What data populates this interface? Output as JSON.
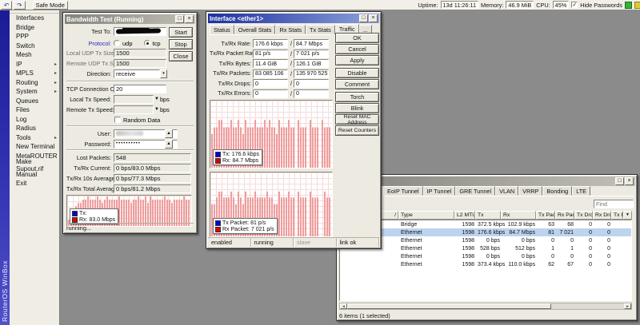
{
  "topbar": {
    "undo_icon": "↶",
    "redo_icon": "↷",
    "safe_mode_label": "Safe Mode",
    "uptime_label": "Uptime:",
    "uptime_value": "13d 11:26:11",
    "memory_label": "Memory:",
    "memory_value": "46.9 MiB",
    "cpu_label": "CPU:",
    "cpu_value": "45%",
    "hide_passwords_label": "Hide Passwords",
    "checkmark": "✓"
  },
  "sidebar": {
    "brand": "RouterOS WinBox",
    "items": [
      {
        "label": "Interfaces",
        "submenu": false
      },
      {
        "label": "Bridge",
        "submenu": false
      },
      {
        "label": "PPP",
        "submenu": false
      },
      {
        "label": "Switch",
        "submenu": false
      },
      {
        "label": "Mesh",
        "submenu": false
      },
      {
        "label": "IP",
        "submenu": true
      },
      {
        "label": "MPLS",
        "submenu": true
      },
      {
        "label": "Routing",
        "submenu": true
      },
      {
        "label": "System",
        "submenu": true
      },
      {
        "label": "Queues",
        "submenu": false
      },
      {
        "label": "Files",
        "submenu": false
      },
      {
        "label": "Log",
        "submenu": false
      },
      {
        "label": "Radius",
        "submenu": false
      },
      {
        "label": "Tools",
        "submenu": true
      },
      {
        "label": "New Terminal",
        "submenu": false
      },
      {
        "label": "MetaROUTER",
        "submenu": false
      },
      {
        "label": "Make Supout.rif",
        "submenu": false
      },
      {
        "label": "Manual",
        "submenu": false
      },
      {
        "label": "Exit",
        "submenu": false
      }
    ]
  },
  "bandwidth_test": {
    "title": "Bandwidth Test (Running)",
    "minimize_glyph": "□",
    "close_glyph": "×",
    "test_to_label": "Test To:",
    "test_to_value": "",
    "protocol_label": "Protocol:",
    "protocol_udp": "udp",
    "protocol_tcp": "tcp",
    "protocol_selected": "tcp",
    "local_udp_label": "Local UDP Tx Size:",
    "local_udp_value": "1500",
    "remote_udp_label": "Remote UDP Tx Size:",
    "remote_udp_value": "1500",
    "direction_label": "Direction:",
    "direction_value": "receive",
    "tcp_count_label": "TCP Connection Count:",
    "tcp_count_value": "20",
    "local_tx_label": "Local Tx Speed:",
    "local_tx_value": "",
    "local_tx_unit": "bps",
    "remote_tx_label": "Remote Tx Speed:",
    "remote_tx_value": "",
    "remote_tx_unit": "bps",
    "random_data_label": "Random Data",
    "random_data_checked": false,
    "user_label": "User:",
    "user_value": "",
    "password_label": "Password:",
    "password_value": "••••••••••",
    "lost_packets_label": "Lost Packets:",
    "lost_packets_value": "548",
    "current_label": "Tx/Rx Current:",
    "current_value": "0 bps/83.0 Mbps",
    "avg10_label": "Tx/Rx 10s Average:",
    "avg10_value": "0 bps/77.3 Mbps",
    "avg_total_label": "Tx/Rx Total Average:",
    "avg_total_value": "0 bps/81.2 Mbps",
    "buttons": [
      "Start",
      "Stop",
      "Close"
    ],
    "legend": {
      "tx_label": "Tx:",
      "tx_value": "",
      "rx_label": "Rx:",
      "rx_value": "83.0 Mbps"
    },
    "status": "running...",
    "graph_bars": "235677889888987898888988887889889798888898878888988"
  },
  "interface_dialog": {
    "title": "Interface <ether1>",
    "minimize_glyph": "□",
    "close_glyph": "×",
    "tabs": [
      "Status",
      "Overall Stats",
      "Rx Stats",
      "Tx Stats",
      "Traffic"
    ],
    "active_tab": "Traffic",
    "overflow_tab": "...",
    "separator": "/",
    "stats": [
      {
        "label": "Tx/Rx Rate:",
        "tx": "176.6 kbps",
        "rx": "84.7 Mbps"
      },
      {
        "label": "Tx/Rx Packet Rate:",
        "tx": "81 p/s",
        "rx": "7 021 p/s"
      },
      {
        "label": "Tx/Rx Bytes:",
        "tx": "11.4 GiB",
        "rx": "126.1 GiB"
      },
      {
        "label": "Tx/Rx Packets:",
        "tx": "83 085 106",
        "rx": "135 970 525"
      },
      {
        "label": "Tx/Rx Drops:",
        "tx": "0",
        "rx": "0"
      },
      {
        "label": "Tx/Rx Errors:",
        "tx": "0",
        "rx": "0"
      }
    ],
    "buttons": [
      "OK",
      "Cancel",
      "Apply",
      "Disable",
      "Comment",
      "Torch",
      "Blink",
      "Reset MAC Address",
      "Reset Counters"
    ],
    "legend1": {
      "tx_label": "Tx:",
      "tx_value": "176.6 kbps",
      "rx_label": "Rx:",
      "rx_value": "84.7 Mbps"
    },
    "legend2": {
      "tx_label": "Tx Packet:",
      "tx_value": "81 p/s",
      "rx_label": "Rx Packet:",
      "rx_value": "7 021 p/s"
    },
    "graph1_bars": "566776667667657666766676766576667660766607666076660",
    "graph2_bars": "556776667657657666766667665576667660766607666007660",
    "status_segments": [
      {
        "label": "enabled",
        "dim": false
      },
      {
        "label": "running",
        "dim": false
      },
      {
        "label": "slave",
        "dim": true
      },
      {
        "label": "link ok",
        "dim": false
      }
    ]
  },
  "interface_list": {
    "minimize_glyph": "□",
    "close_glyph": "×",
    "tabs": [
      "EoIP Tunnel",
      "IP Tunnel",
      "GRE Tunnel",
      "VLAN",
      "VRRP",
      "Bonding",
      "LTE"
    ],
    "find_placeholder": "Find",
    "sort_indicator": "/",
    "columns": [
      "Type",
      "L2 MTU",
      "Tx",
      "Rx",
      "Tx Pac...",
      "Rx Pac...",
      "Tx Drops",
      "Rx Drops",
      "Tx E"
    ],
    "column_picker_glyph": "▼",
    "rows": [
      {
        "type": "Bridge",
        "l2mtu": "1598",
        "tx": "372.5 kbps",
        "rx": "102.9 kbps",
        "tx_pac": "63",
        "rx_pac": "68",
        "tx_drops": "0",
        "rx_drops": "0",
        "selected": false
      },
      {
        "type": "Ethernet",
        "l2mtu": "1598",
        "tx": "176.6 kbps",
        "rx": "84.7 Mbps",
        "tx_pac": "81",
        "rx_pac": "7 021",
        "tx_drops": "0",
        "rx_drops": "0",
        "selected": true
      },
      {
        "type": "Ethernet",
        "l2mtu": "1598",
        "tx": "0 bps",
        "rx": "0 bps",
        "tx_pac": "0",
        "rx_pac": "0",
        "tx_drops": "0",
        "rx_drops": "0",
        "selected": false
      },
      {
        "type": "Ethernet",
        "l2mtu": "1598",
        "tx": "528 bps",
        "rx": "512 bps",
        "tx_pac": "1",
        "rx_pac": "1",
        "tx_drops": "0",
        "rx_drops": "0",
        "selected": false
      },
      {
        "type": "Ethernet",
        "l2mtu": "1598",
        "tx": "0 bps",
        "rx": "0 bps",
        "tx_pac": "0",
        "rx_pac": "0",
        "tx_drops": "0",
        "rx_drops": "0",
        "selected": false
      },
      {
        "type": "Ethernet",
        "l2mtu": "1598",
        "tx": "373.4 kbps",
        "rx": "110.0 kbps",
        "tx_pac": "62",
        "rx_pac": "67",
        "tx_drops": "0",
        "rx_drops": "0",
        "selected": false
      }
    ],
    "status": "6 items (1 selected)"
  },
  "colors": {
    "titlebar_active": "#1c2f9e",
    "selection": "#bdd3ee",
    "graph_bar": "#ef9d9d",
    "tx_swatch": "#0000dd",
    "rx_swatch": "#dd0000",
    "sidebar_strip": "#3434b4"
  }
}
